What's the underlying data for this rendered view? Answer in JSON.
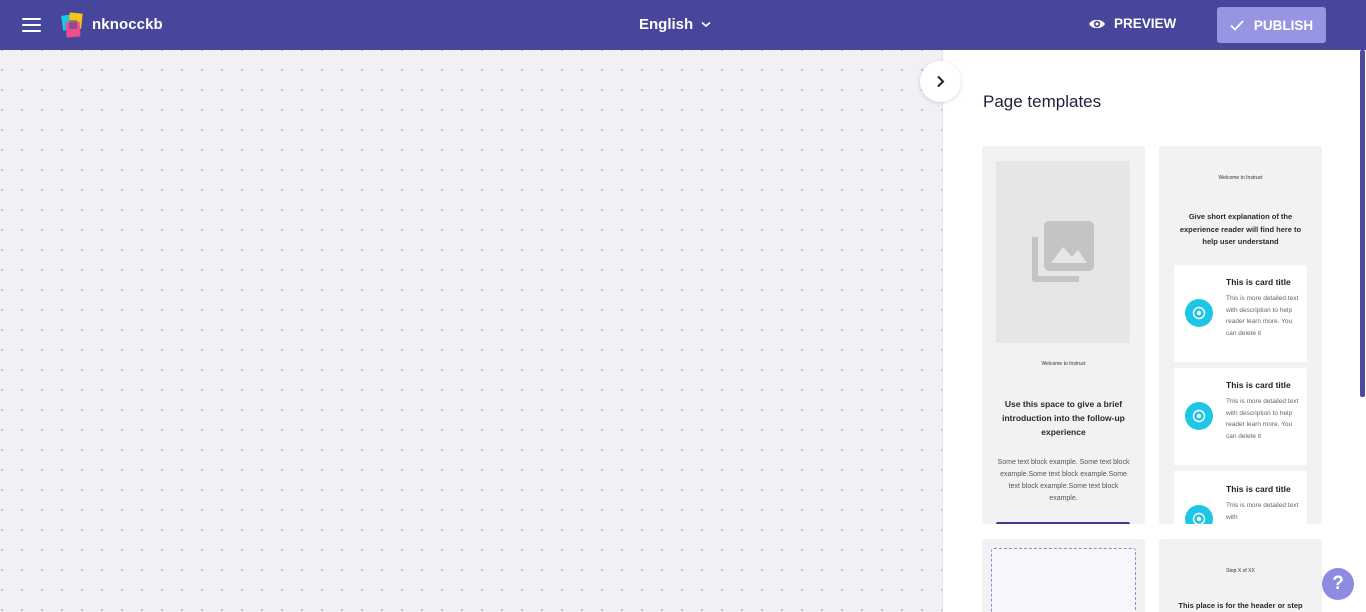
{
  "header": {
    "brand": "nknocckb",
    "language": "English",
    "preview_label": "PREVIEW",
    "publish_label": "PUBLISH"
  },
  "panel": {
    "title": "Page templates",
    "templates": [
      {
        "label_small": "Welcome to Instruct",
        "heading": "Use this space to give a brief introduction into the follow-up experience",
        "body": "Some text block example. Some text block example.Some text block example.Some text block example.Some text block example."
      },
      {
        "label_small": "Welcome to Instruct",
        "heading": "Give short explanation of the experience reader will find here to help user understand",
        "cards": [
          {
            "title": "This is card title",
            "desc": "This is more detailed text with description to help reader learn more. You can delete it"
          },
          {
            "title": "This is card title",
            "desc": "This is more detailed text with description to help reader learn more. You can delete it"
          },
          {
            "title": "This is card title",
            "desc": "This is more detailed text with"
          }
        ]
      },
      {},
      {
        "label_small": "Step X of XX",
        "heading": "This place is for the header or step"
      }
    ]
  },
  "help": {
    "label": "?"
  },
  "colors": {
    "topbar": "#46469a",
    "publish": "#9595e3",
    "accent_cyan": "#1cc6e6",
    "help": "#8c8ce0"
  }
}
